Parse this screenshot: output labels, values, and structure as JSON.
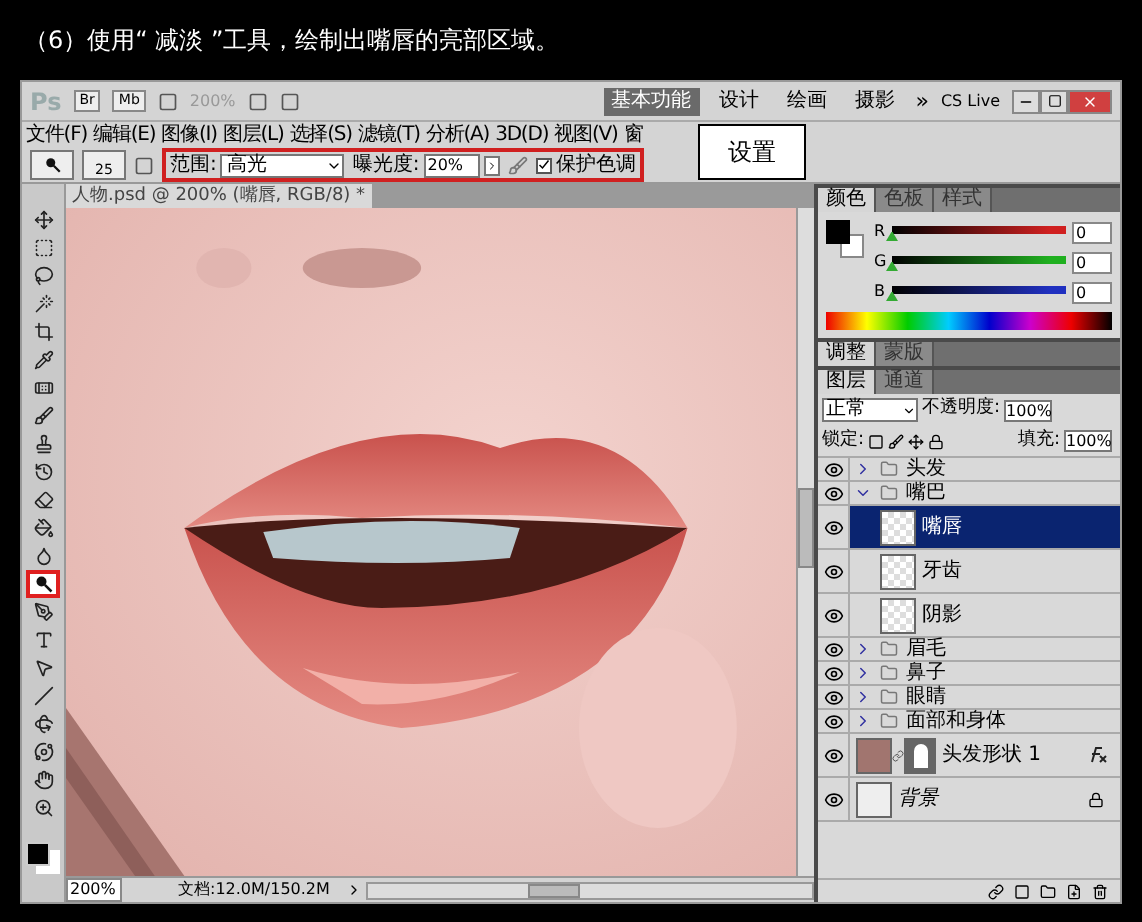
{
  "caption": "（6）使用“ 减淡 ”工具，绘制出嘴唇的亮部区域。",
  "app_bar": {
    "logo": "Ps",
    "buttons": [
      "Br",
      "Mb"
    ],
    "zoom": "200%",
    "workspaces": [
      {
        "label": "基本功能",
        "selected": true
      },
      {
        "label": "设计",
        "selected": false
      },
      {
        "label": "绘画",
        "selected": false
      },
      {
        "label": "摄影",
        "selected": false
      }
    ],
    "more": "»",
    "cs_live": "CS Live"
  },
  "menu": [
    "文件(F)",
    "编辑(E)",
    "图像(I)",
    "图层(L)",
    "选择(S)",
    "滤镜(T)",
    "分析(A)",
    "3D(D)",
    "视图(V)",
    "窗"
  ],
  "callout": "设置",
  "options": {
    "brush_size": "25",
    "range_label": "范围:",
    "range_value": "高光",
    "exposure_label": "曝光度:",
    "exposure_value": "20%",
    "protect_tones": {
      "label": "保护色调",
      "checked": true
    }
  },
  "tools": [
    {
      "kind": "move",
      "selected": false
    },
    {
      "kind": "marquee",
      "selected": false
    },
    {
      "kind": "lasso",
      "selected": false
    },
    {
      "kind": "wand",
      "selected": false
    },
    {
      "kind": "crop",
      "selected": false
    },
    {
      "kind": "eyedropper",
      "selected": false
    },
    {
      "kind": "heal",
      "selected": false
    },
    {
      "kind": "brush",
      "selected": false
    },
    {
      "kind": "stamp",
      "selected": false
    },
    {
      "kind": "history",
      "selected": false
    },
    {
      "kind": "eraser",
      "selected": false
    },
    {
      "kind": "bucket",
      "selected": false
    },
    {
      "kind": "blur",
      "selected": false
    },
    {
      "kind": "dodge",
      "selected": true
    },
    {
      "kind": "pen",
      "selected": false
    },
    {
      "kind": "type",
      "selected": false
    },
    {
      "kind": "path",
      "selected": false
    },
    {
      "kind": "line",
      "selected": false
    },
    {
      "kind": "rotate3d",
      "selected": false
    },
    {
      "kind": "orbit",
      "selected": false
    },
    {
      "kind": "hand",
      "selected": false
    },
    {
      "kind": "zoom",
      "selected": false
    }
  ],
  "document": {
    "tab": "人物.psd @ 200% (嘴唇, RGB/8) *",
    "zoom": "200%",
    "doc_size": "文档:12.0M/150.2M"
  },
  "color_panel": {
    "tabs": [
      {
        "label": "颜色",
        "selected": true
      },
      {
        "label": "色板",
        "selected": false
      },
      {
        "label": "样式",
        "selected": false
      }
    ],
    "channels": [
      {
        "label": "R",
        "value": "0",
        "level": 0,
        "color": "#d02020"
      },
      {
        "label": "G",
        "value": "0",
        "level": 0,
        "color": "#20b020"
      },
      {
        "label": "B",
        "value": "0",
        "level": 0,
        "color": "#2030c0"
      }
    ]
  },
  "adjust_panel": {
    "tabs": [
      {
        "label": "调整",
        "selected": true
      },
      {
        "label": "蒙版",
        "selected": false
      }
    ]
  },
  "layers_panel": {
    "tabs": [
      {
        "label": "图层",
        "selected": true
      },
      {
        "label": "通道",
        "selected": false
      }
    ],
    "blend_mode": "正常",
    "opacity_label": "不透明度:",
    "opacity": "100%",
    "lock_label": "锁定:",
    "fill_label": "填充:",
    "fill": "100%",
    "layers": [
      {
        "kind": "group",
        "name": "头发",
        "visible": true,
        "expanded": false,
        "selected": false
      },
      {
        "kind": "group",
        "name": "嘴巴",
        "visible": true,
        "expanded": true,
        "selected": false,
        "children": [
          {
            "kind": "pixel",
            "name": "嘴唇",
            "visible": true,
            "selected": true
          },
          {
            "kind": "pixel",
            "name": "牙齿",
            "visible": true,
            "selected": false
          },
          {
            "kind": "pixel",
            "name": "阴影",
            "visible": true,
            "selected": false
          }
        ]
      },
      {
        "kind": "group",
        "name": "眉毛",
        "visible": true,
        "expanded": false,
        "selected": false
      },
      {
        "kind": "group",
        "name": "鼻子",
        "visible": true,
        "expanded": false,
        "selected": false
      },
      {
        "kind": "group",
        "name": "眼睛",
        "visible": true,
        "expanded": false,
        "selected": false
      },
      {
        "kind": "group",
        "name": "面部和身体",
        "visible": true,
        "expanded": false,
        "selected": false
      },
      {
        "kind": "shape",
        "name": "头发形状 1",
        "visible": true,
        "selected": false
      },
      {
        "kind": "background",
        "name": "背景",
        "visible": true,
        "selected": false
      }
    ]
  }
}
